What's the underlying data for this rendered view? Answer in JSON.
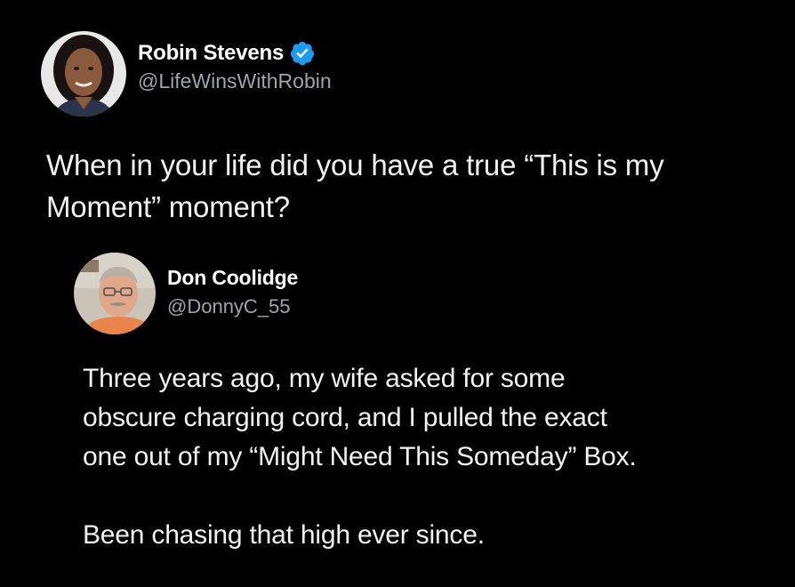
{
  "original_tweet": {
    "author": {
      "display_name": "Robin Stevens",
      "handle": "@LifeWinsWithRobin",
      "verified": true,
      "verified_color": "#1d9bf0"
    },
    "text_lines": [
      "When in your life did you have a true “This is my",
      "Moment” moment?"
    ]
  },
  "reply_tweet": {
    "author": {
      "display_name": "Don Coolidge",
      "handle": "@DonnyC_55"
    },
    "paragraph1_lines": [
      "Three years ago, my wife asked for some",
      "obscure charging cord, and I pulled the exact",
      "one out of my “Might Need This Someday” Box."
    ],
    "paragraph2": "Been chasing that high ever since."
  },
  "colors": {
    "background": "#000000",
    "text": "#f2f2f2",
    "secondary_text": "#9da4ab",
    "accent": "#1d9bf0"
  }
}
